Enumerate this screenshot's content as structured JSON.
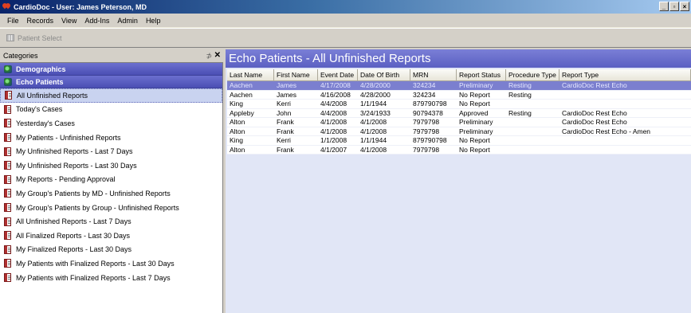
{
  "window": {
    "title": "CardioDoc - User: James Peterson, MD",
    "buttons": {
      "minimize": "_",
      "maximize": "▫",
      "close": "×"
    }
  },
  "menu": [
    "File",
    "Records",
    "View",
    "Add-Ins",
    "Admin",
    "Help"
  ],
  "toolbar": {
    "patient_select": "Patient Select"
  },
  "categories_panel": {
    "title": "Categories",
    "pin": "⊅",
    "close": "✕",
    "groups": [
      "Demographics",
      "Echo Patients"
    ],
    "items": [
      "All Unfinished Reports",
      "Today's Cases",
      "Yesterday's Cases",
      "My Patients - Unfinished Reports",
      "My Unfinished Reports - Last 7 Days",
      "My Unfinished Reports - Last 30 Days",
      "My Reports - Pending Approval",
      "My Group's Patients by MD - Unfinished Reports",
      "My Group's Patients by Group - Unfinished Reports",
      "All Unfinished Reports - Last 7 Days",
      "All Finalized Reports - Last 30 Days",
      "My Finalized Reports - Last 30 Days",
      "My Patients with Finalized Reports - Last 30 Days",
      "My Patients with Finalized Reports - Last 7 Days"
    ],
    "selected_item": "All Unfinished Reports"
  },
  "main": {
    "title": "Echo Patients - All Unfinished Reports",
    "columns": [
      "Last Name",
      "First Name",
      "Event Date",
      "Date Of Birth",
      "MRN",
      "Report Status",
      "Procedure Type",
      "Report Type"
    ],
    "rows": [
      [
        "Aachen",
        "James",
        "4/17/2008",
        "4/28/2000",
        "324234",
        "Preliminary",
        "Resting",
        "CardioDoc Rest Echo"
      ],
      [
        "Aachen",
        "James",
        "4/16/2008",
        "4/28/2000",
        "324234",
        "No Report",
        "Resting",
        ""
      ],
      [
        "King",
        "Kerri",
        "4/4/2008",
        "1/1/1944",
        "879790798",
        "No Report",
        "",
        ""
      ],
      [
        "Appleby",
        "John",
        "4/4/2008",
        "3/24/1933",
        "90794378",
        "Approved",
        "Resting",
        "CardioDoc Rest Echo"
      ],
      [
        "Alton",
        "Frank",
        "4/1/2008",
        "4/1/2008",
        "7979798",
        "Preliminary",
        "",
        "CardioDoc Rest Echo"
      ],
      [
        "Alton",
        "Frank",
        "4/1/2008",
        "4/1/2008",
        "7979798",
        "Preliminary",
        "",
        "CardioDoc Rest Echo - Amen"
      ],
      [
        "King",
        "Kerri",
        "1/1/2008",
        "1/1/1944",
        "879790798",
        "No Report",
        "",
        ""
      ],
      [
        "Alton",
        "Frank",
        "4/1/2007",
        "4/1/2008",
        "7979798",
        "No Report",
        "",
        ""
      ]
    ],
    "selected_row": 0
  }
}
